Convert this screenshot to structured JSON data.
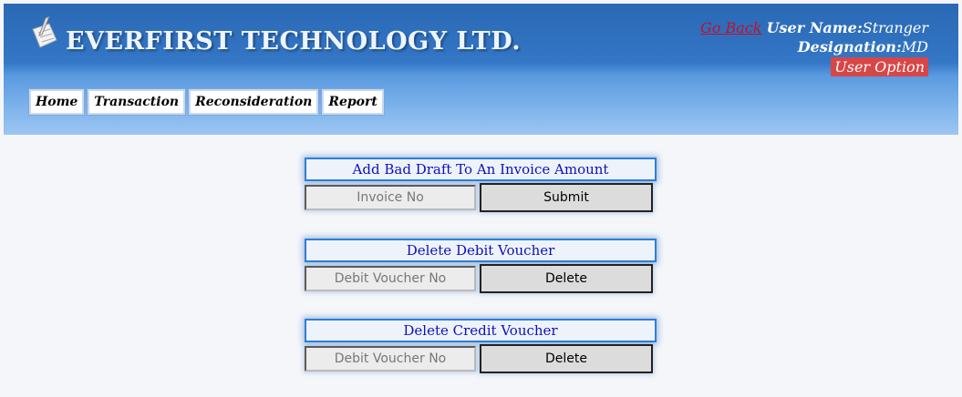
{
  "header": {
    "brand": "EVERFIRST TECHNOLOGY LTD.",
    "logo_icon": "notepad-pen-icon",
    "go_back": "Go Back",
    "user_name_label": "User Name:",
    "user_name_value": "Stranger",
    "designation_label": "Designation:",
    "designation_value": "MD",
    "user_option": "User Option"
  },
  "nav": {
    "items": [
      {
        "label": "Home"
      },
      {
        "label": "Transaction"
      },
      {
        "label": "Reconsideration"
      },
      {
        "label": "Report"
      }
    ]
  },
  "sections": [
    {
      "title": "Add Bad Draft To An Invoice Amount",
      "placeholder": "Invoice No",
      "button": "Submit"
    },
    {
      "title": "Delete Debit Voucher",
      "placeholder": "Debit Voucher No",
      "button": "Delete"
    },
    {
      "title": "Delete Credit Voucher",
      "placeholder": "Debit Voucher No",
      "button": "Delete"
    }
  ],
  "colors": {
    "header_top": "#2a68b4",
    "header_bottom": "#9cc6f2",
    "go_back": "#c0102a",
    "user_option_bg": "#d84646",
    "section_title_text": "#1010b8",
    "section_border": "#2f7fd6"
  }
}
